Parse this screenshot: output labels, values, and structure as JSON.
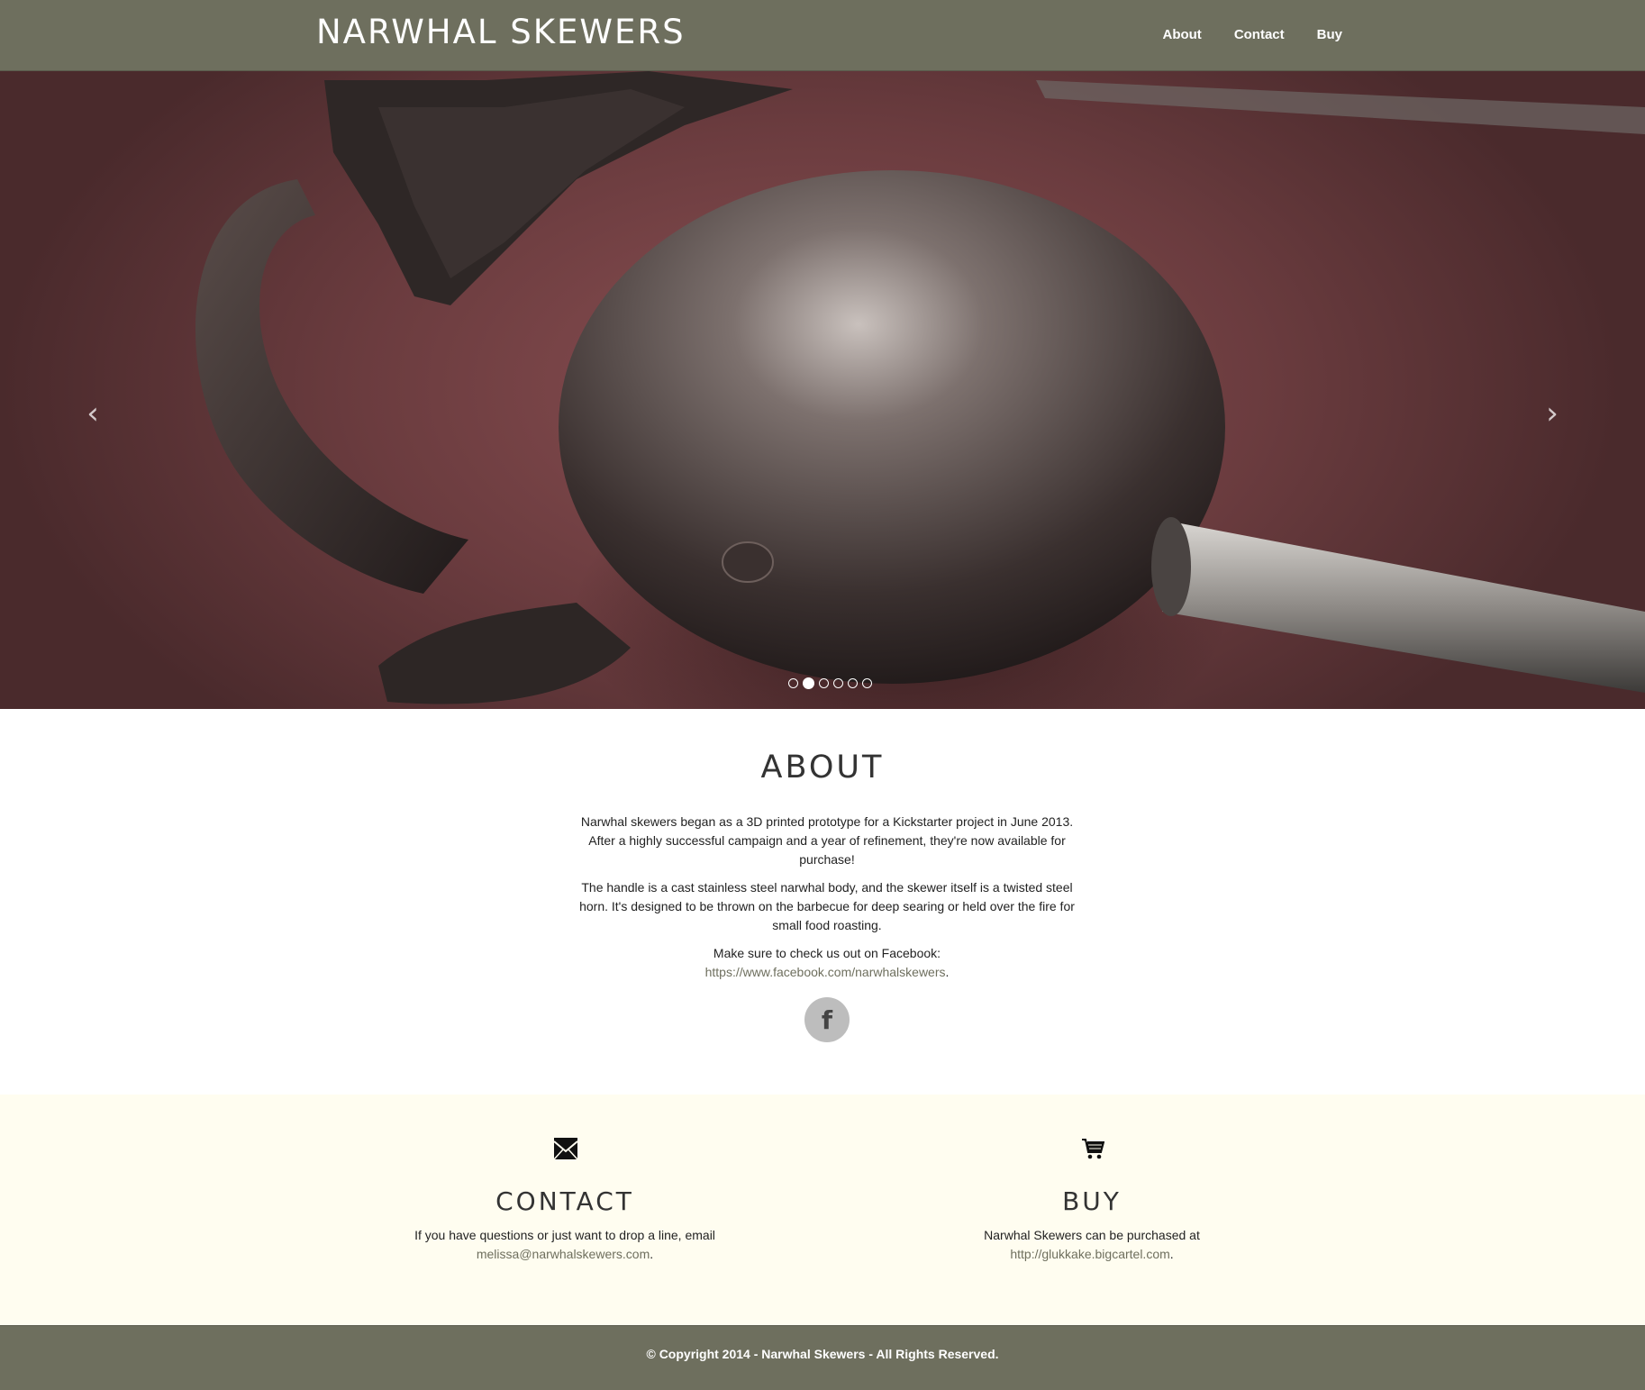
{
  "header": {
    "brand": "NARWHAL SKEWERS",
    "nav": [
      {
        "label": "About"
      },
      {
        "label": "Contact"
      },
      {
        "label": "Buy"
      }
    ]
  },
  "carousel": {
    "prev_icon": "chevron-left-icon",
    "next_icon": "chevron-right-icon",
    "prev_glyph": "‹",
    "next_glyph": "›",
    "slide_count": 6,
    "active_index": 1
  },
  "about": {
    "title": "ABOUT",
    "p1": "Narwhal skewers began as a 3D printed prototype for a Kickstarter project in June 2013. After a highly successful campaign and a year of refinement, they're now available for purchase!",
    "p2": "The handle is a cast stainless steel narwhal body, and the skewer itself is a twisted steel horn. It's designed to be thrown on the barbecue for deep searing or held over the fire for small food roasting.",
    "p3_prefix": "Make sure to check us out on Facebook:",
    "facebook_link": "https://www.facebook.com/narwhalskewers",
    "p3_suffix": ".",
    "facebook_icon": "f"
  },
  "contact": {
    "icon": "envelope-icon",
    "title": "CONTACT",
    "text": "If you have questions or just want to drop a line, email",
    "link": "melissa@narwhalskewers.com",
    "suffix": "."
  },
  "buy": {
    "icon": "shopping-cart-icon",
    "title": "BUY",
    "text": "Narwhal Skewers can be purchased at",
    "link": "http://glukkake.bigcartel.com",
    "suffix": "."
  },
  "footer": {
    "copyright": "© Copyright 2014 - Narwhal Skewers - All Rights Reserved."
  },
  "colors": {
    "bar": "#6e6f5e",
    "info_bg": "#fffdf0",
    "link": "#6e6f5e"
  }
}
